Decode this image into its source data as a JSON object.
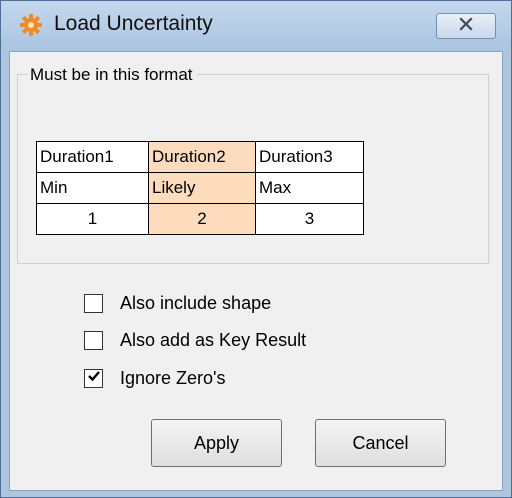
{
  "window": {
    "title": "Load Uncertainty",
    "title_icon": "orange-gear-icon",
    "close_icon": "close-x-icon"
  },
  "format_group": {
    "label": "Must be in this format",
    "table": {
      "highlight_color": "#fcdcbd",
      "rows": [
        [
          "Duration1",
          "Duration2",
          "Duration3"
        ],
        [
          "Min",
          "Likely",
          "Max"
        ],
        [
          "1",
          "2",
          "3"
        ]
      ]
    }
  },
  "options": [
    {
      "label": "Also include shape",
      "checked": false
    },
    {
      "label": "Also add as Key Result",
      "checked": false
    },
    {
      "label": "Ignore Zero's",
      "checked": true
    }
  ],
  "buttons": {
    "apply": "Apply",
    "cancel": "Cancel"
  }
}
